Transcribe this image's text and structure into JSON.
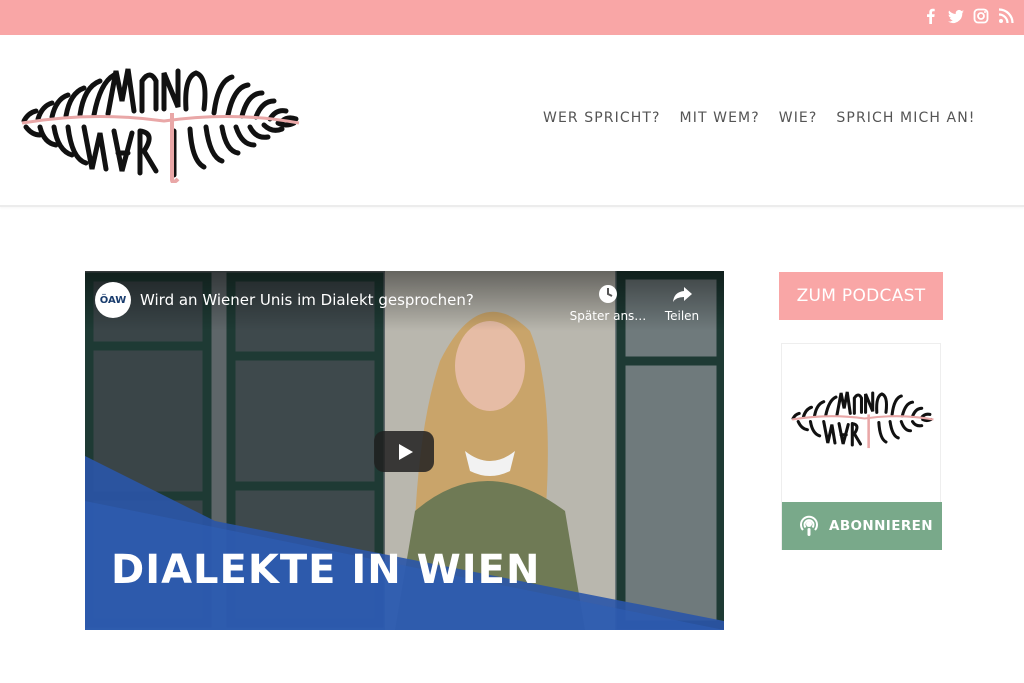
{
  "colors": {
    "pink": "#f9a6a6",
    "green": "#79a98a",
    "nav_text": "#555555"
  },
  "social": [
    "facebook-icon",
    "twitter-icon",
    "instagram-icon",
    "rss-icon"
  ],
  "nav": {
    "items": [
      {
        "label": "WER SPRICHT?"
      },
      {
        "label": "MIT WEM?"
      },
      {
        "label": "WIE?"
      },
      {
        "label": "SPRICH MICH AN!"
      }
    ]
  },
  "video": {
    "channel_label": "ÖAW",
    "title": "Wird an Wiener Unis im Dialekt gesprochen?",
    "watch_later_label": "Später ans…",
    "share_label": "Teilen",
    "caption": "DIALEKTE IN WIEN"
  },
  "sidebar": {
    "podcast_label": "ZUM PODCAST",
    "subscribe_label": "ABONNIEREN"
  }
}
